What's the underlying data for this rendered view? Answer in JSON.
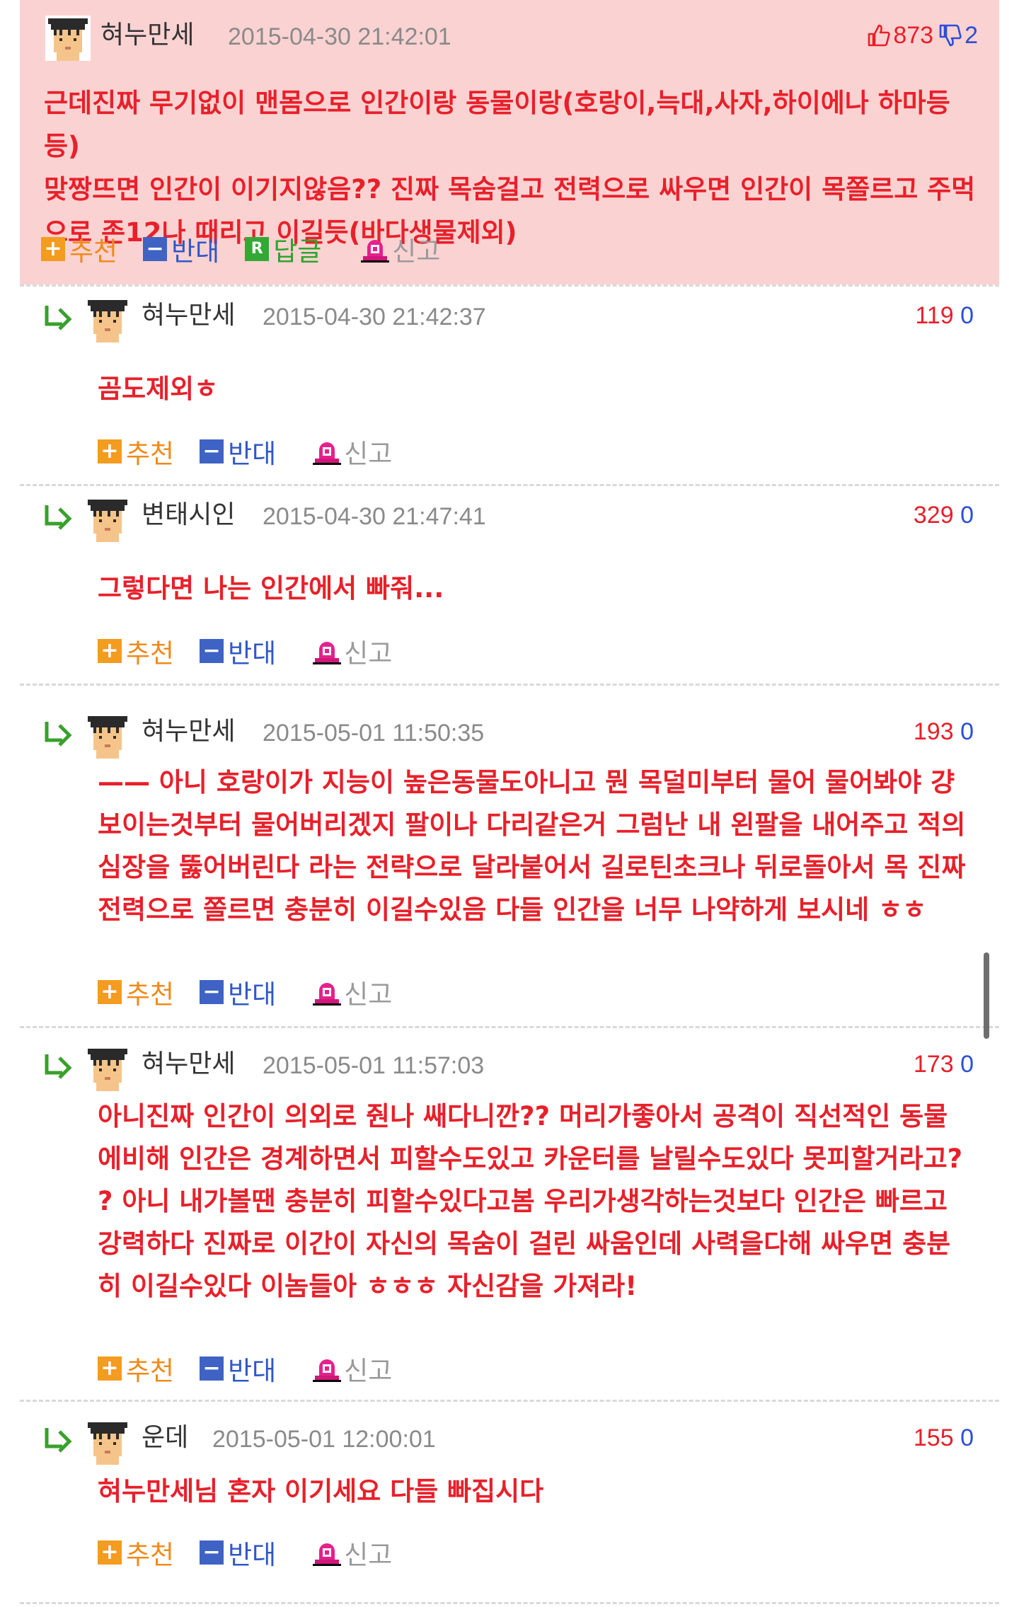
{
  "post": {
    "author": "혀누만세",
    "timestamp": "2015-04-30 21:42:01",
    "upvotes": "873",
    "downvotes": "2",
    "body_lines": [
      "근데진짜 무기없이 맨몸으로 인간이랑 동물이랑(호랑이,늑대,사자,하이에나 하마등등)",
      "맞짱뜨면 인간이 이기지않음?? 진짜 목숨걸고 전력으로 싸우면 인간이 목쫄르고 주먹",
      "으로 존12나 때리고 이길듯(바다생물제외)"
    ],
    "actions": {
      "recommend": "추천",
      "oppose": "반대",
      "reply": "답글",
      "report": "신고"
    }
  },
  "comment_actions": {
    "recommend": "추천",
    "oppose": "반대",
    "report": "신고"
  },
  "comments": [
    {
      "author": "혀누만세",
      "timestamp": "2015-04-30 21:42:37",
      "upvotes": "119",
      "downvotes": "0",
      "body_lines": [
        "곰도제외ㅎ"
      ]
    },
    {
      "author": "변태시인",
      "timestamp": "2015-04-30 21:47:41",
      "upvotes": "329",
      "downvotes": "0",
      "body_lines": [
        "그렇다면 나는 인간에서 빠줘..."
      ]
    },
    {
      "author": "혀누만세",
      "timestamp": "2015-05-01 11:50:35",
      "upvotes": "193",
      "downvotes": "0",
      "body_lines": [
        "—— 아니 호랑이가 지능이 높은동물도아니고 뭔 목덜미부터 물어 물어봐야 걍",
        "보이는것부터 물어버리겠지 팔이나 다리같은거 그럼난 내 왼팔을 내어주고 적의",
        "심장을 뚫어버린다 라는 전략으로 달라붙어서 길로틴초크나 뒤로돌아서 목 진짜",
        "전력으로 쫄르면 충분히 이길수있음 다들 인간을 너무 나약하게 보시네 ㅎㅎ"
      ]
    },
    {
      "author": "혀누만세",
      "timestamp": "2015-05-01 11:57:03",
      "upvotes": "173",
      "downvotes": "0",
      "body_lines": [
        "아니진짜 인간이 의외로 줜나 쌔다니깐?? 머리가좋아서 공격이 직선적인 동물",
        "에비해 인간은 경계하면서 피할수도있고 카운터를 날릴수도있다 못피할거라고?",
        "? 아니 내가볼땐 충분히 피할수있다고봄 우리가생각하는것보다 인간은 빠르고",
        "강력하다 진짜로 이간이 자신의 목숨이 걸린 싸움인데 사력을다해 싸우면 충분",
        "히 이길수있다 이놈들아 ㅎㅎㅎ 자신감을 가져라!"
      ]
    },
    {
      "author": "운데",
      "timestamp": "2015-05-01 12:00:01",
      "upvotes": "155",
      "downvotes": "0",
      "body_lines": [
        "혀누만세님 혼자 이기세요 다들 빠집시다"
      ]
    }
  ],
  "icons": {
    "avatar": "avatar-icon",
    "reply": "reply-arrow-icon",
    "thumbs_up": "thumbs-up-icon",
    "thumbs_down": "thumbs-down-icon",
    "plus": "plus-icon",
    "minus": "minus-icon",
    "reply_badge": "reply-badge-icon",
    "report": "siren-icon"
  },
  "colors": {
    "post_background": "#fbd2d2",
    "text_red": "#e8202a",
    "down_blue": "#2a4fd6",
    "recommend_orange": "#f39c1f",
    "oppose_blue": "#3f63c4",
    "reply_green": "#33a935"
  }
}
